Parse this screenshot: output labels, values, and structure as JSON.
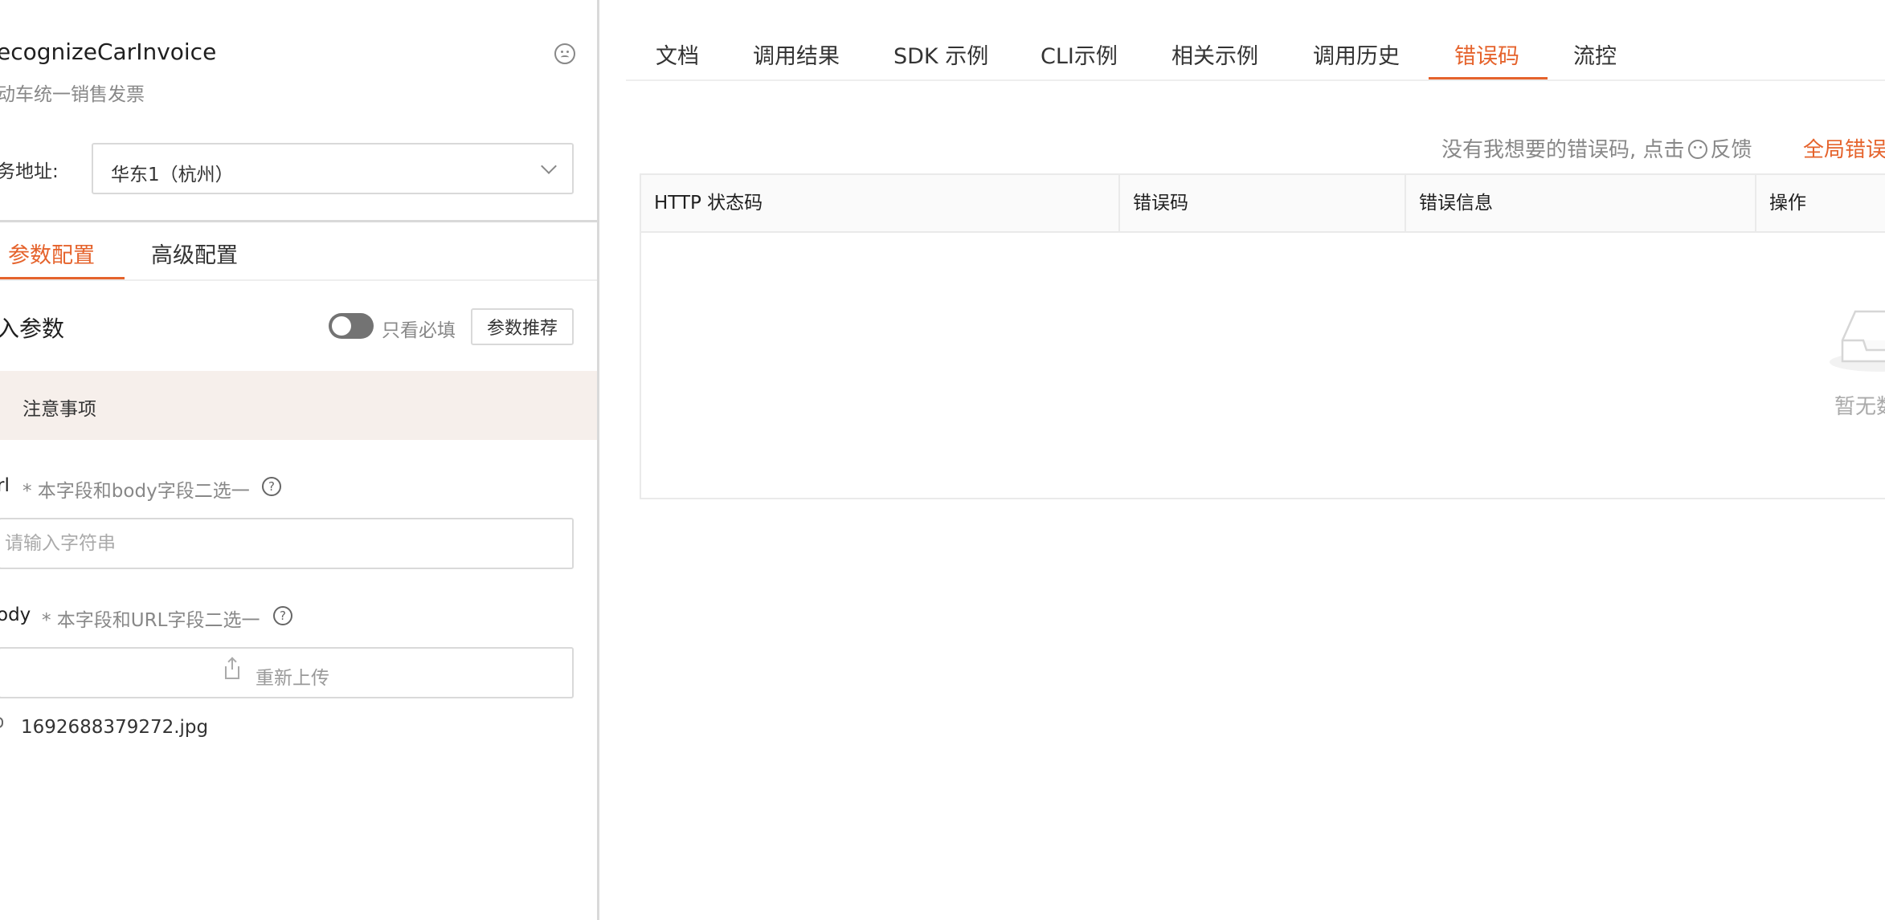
{
  "left": {
    "api_title": "ecognizeCarInvoice",
    "api_subtitle": "动车统一销售发票",
    "service_label": "务地址:",
    "service_value": "华东1（杭州）",
    "tabs": [
      {
        "label": "参数配置",
        "active": true
      },
      {
        "label": "高级配置",
        "active": false
      }
    ],
    "input_params_title": "入参数",
    "toggle_label": "只看必填",
    "recommend_button": "参数推荐",
    "notice": "注意事项",
    "url_field": {
      "name": "rl",
      "hint": "* 本字段和body字段二选一",
      "placeholder": "请输入字符串",
      "help_glyph": "?"
    },
    "body_field": {
      "name": "ody",
      "hint": "* 本字段和URL字段二选一",
      "help_glyph": "?",
      "upload_label": "重新上传",
      "file_name": "1692688379272.jpg"
    }
  },
  "right": {
    "tabs": [
      {
        "label": "文档",
        "active": false
      },
      {
        "label": "调用结果",
        "active": false
      },
      {
        "label": "SDK 示例",
        "active": false
      },
      {
        "label": "CLI示例",
        "active": false
      },
      {
        "label": "相关示例",
        "active": false
      },
      {
        "label": "调用历史",
        "active": false
      },
      {
        "label": "错误码",
        "active": true
      },
      {
        "label": "流控",
        "active": false
      }
    ],
    "hint_prefix": "没有我想要的错误码, 点击",
    "hint_suffix": "反馈",
    "global_link": "全局错误",
    "table": {
      "columns": [
        "HTTP 状态码",
        "错误码",
        "错误信息",
        "操作"
      ],
      "rows": [],
      "empty_text": "暂无数据"
    }
  },
  "colors": {
    "accent": "#e5632c",
    "notice_bg": "#f6efeb",
    "border": "#d9d9d9"
  }
}
